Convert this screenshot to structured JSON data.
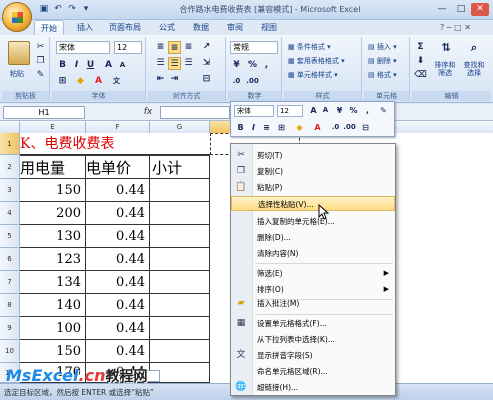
{
  "title_bar": {
    "title": "合作路水电费收费表 [兼容模式] - Microsoft Excel",
    "qat": [
      "save-icon",
      "undo-icon",
      "redo-icon",
      "dropdown-icon"
    ]
  },
  "tabs": [
    "开始",
    "插入",
    "页面布局",
    "公式",
    "数据",
    "审阅",
    "视图"
  ],
  "ribbon": {
    "paste": "粘贴",
    "font_name": "宋体",
    "font_size": "12",
    "number_format": "常规",
    "percent": "%",
    "comma": ",",
    "styles": [
      "条件格式",
      "套用表格格式",
      "单元格样式"
    ],
    "cells": [
      "插入",
      "删除",
      "格式"
    ],
    "sort_filter": "排序和\n筛选",
    "find_select": "查找和\n选择",
    "groups": [
      "剪贴板",
      "字体",
      "对齐方式",
      "数字",
      "样式",
      "单元格",
      "编辑"
    ]
  },
  "formula_bar": {
    "name_box": "H1",
    "fx": "fx"
  },
  "columns": [
    "E",
    "F",
    "G",
    "H"
  ],
  "rows": [
    "1",
    "2",
    "3",
    "4",
    "5",
    "6",
    "7",
    "8",
    "9",
    "10",
    "11"
  ],
  "sheet": {
    "title_fragment": "K、电费收费表",
    "headers": [
      "用电量",
      "电单价",
      "小计"
    ],
    "data": [
      [
        "150",
        "0.44"
      ],
      [
        "200",
        "0.44"
      ],
      [
        "130",
        "0.44"
      ],
      [
        "123",
        "0.44"
      ],
      [
        "134",
        "0.44"
      ],
      [
        "140",
        "0.44"
      ],
      [
        "100",
        "0.44"
      ],
      [
        "150",
        "0.44"
      ],
      [
        "170",
        "0.44"
      ]
    ]
  },
  "mini_toolbar": {
    "font_name": "宋体",
    "font_size": "12"
  },
  "context_menu": [
    {
      "label": "剪切(T)",
      "icon": "cut-icon"
    },
    {
      "label": "复制(C)",
      "icon": "copy-icon"
    },
    {
      "label": "粘贴(P)",
      "icon": "paste-icon"
    },
    {
      "label": "选择性粘贴(V)...",
      "icon": "",
      "highlighted": true
    },
    {
      "label": "插入复制的单元格(E)...",
      "icon": ""
    },
    {
      "label": "删除(D)...",
      "icon": ""
    },
    {
      "label": "清除内容(N)",
      "icon": ""
    },
    {
      "label": "筛选(E)",
      "icon": "",
      "submenu": true
    },
    {
      "label": "排序(O)",
      "icon": "",
      "submenu": true
    },
    {
      "label": "插入批注(M)",
      "icon": "comment-icon"
    },
    {
      "label": "设置单元格格式(F)...",
      "icon": "format-cells-icon"
    },
    {
      "label": "从下拉列表中选择(K)...",
      "icon": ""
    },
    {
      "label": "显示拼音字段(S)",
      "icon": "phonetic-icon"
    },
    {
      "label": "命名单元格区域(R)...",
      "icon": ""
    },
    {
      "label": "超链接(H)...",
      "icon": "hyperlink-icon"
    }
  ],
  "status_bar": {
    "text": "选定目标区域，然后按 ENTER 或选择“粘贴”"
  },
  "sheet_tab": "eet3",
  "watermark": {
    "a": "MsExcel",
    "b": ".cn",
    "c": "教程网"
  }
}
